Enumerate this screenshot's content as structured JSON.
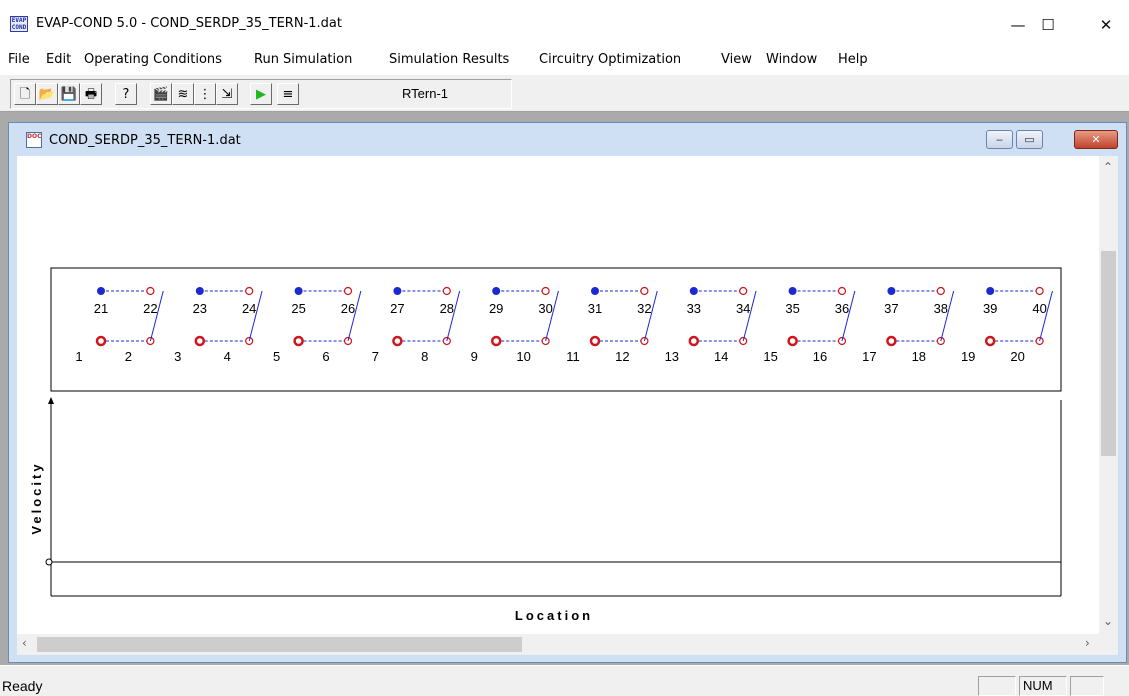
{
  "window": {
    "title": "EVAP-COND 5.0 - COND_SERDP_35_TERN-1.dat",
    "icon_text_top": "EVAP",
    "icon_text_bottom": "COND",
    "minimize": "—",
    "maximize": "☐",
    "close": "✕"
  },
  "menu": [
    "File",
    "Edit",
    "Operating Conditions",
    "Run Simulation",
    "Simulation Results",
    "Circuitry Optimization",
    "View",
    "Window",
    "Help"
  ],
  "toolbar": {
    "buttons": [
      {
        "name": "new-file-icon",
        "glyph": "🗋"
      },
      {
        "name": "open-folder-icon",
        "glyph": "📂"
      },
      {
        "name": "save-disk-icon",
        "glyph": "💾"
      },
      {
        "name": "print-icon",
        "glyph": "🖶"
      },
      {
        "name": "help-icon",
        "glyph": "?"
      },
      {
        "name": "clapboard-icon",
        "glyph": "🎬"
      },
      {
        "name": "refrigerant-icon",
        "glyph": "≋"
      },
      {
        "name": "circuit-steps-icon",
        "glyph": "⋮"
      },
      {
        "name": "flow-arrow-icon",
        "glyph": "⇲"
      },
      {
        "name": "run-play-icon",
        "glyph": "▶"
      },
      {
        "name": "list-lines-icon",
        "glyph": "≡"
      }
    ],
    "refrigerant_label": "RTern-1"
  },
  "child_window": {
    "title": "COND_SERDP_35_TERN-1.dat",
    "icon_text": "DOC",
    "minimize": "‒",
    "restore": "▭",
    "close": "✕"
  },
  "circuit_diagram": {
    "top_row_labels": [
      "21",
      "22",
      "23",
      "24",
      "25",
      "26",
      "27",
      "28",
      "29",
      "30",
      "31",
      "32",
      "33",
      "34",
      "35",
      "36",
      "37",
      "38",
      "39",
      "40"
    ],
    "bottom_row_labels": [
      "1",
      "2",
      "3",
      "4",
      "5",
      "6",
      "7",
      "8",
      "9",
      "10",
      "11",
      "12",
      "13",
      "14",
      "15",
      "16",
      "17",
      "18",
      "19",
      "20"
    ],
    "inlet_color": "#1a2ad0",
    "outlet_color": "#d0151b"
  },
  "chart_data": {
    "type": "line",
    "title": "",
    "xlabel": "Location",
    "ylabel": "Velocity",
    "series": []
  },
  "status": {
    "text": "Ready",
    "panel_caps": "",
    "panel_num": "NUM",
    "panel_scrl": ""
  }
}
